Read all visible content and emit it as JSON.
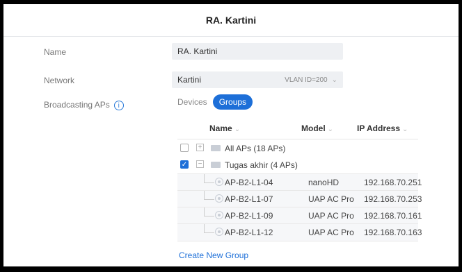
{
  "title": "RA. Kartini",
  "form": {
    "name_label": "Name",
    "name_value": "RA. Kartini",
    "network_label": "Network",
    "network_value": "Kartini",
    "vlan": "VLAN ID=200",
    "aps_label": "Broadcasting APs",
    "info_glyph": "i"
  },
  "tabs": {
    "devices": "Devices",
    "groups": "Groups"
  },
  "table": {
    "headers": {
      "name": "Name",
      "model": "Model",
      "ip": "IP Address"
    },
    "groups": [
      {
        "toggle": "+",
        "name": "All APs (18 APs)",
        "checked": false
      },
      {
        "toggle": "−",
        "name": "Tugas akhir (4 APs)",
        "checked": true
      }
    ],
    "aps": [
      {
        "name": "AP-B2-L1-04",
        "model": "nanoHD",
        "ip": "192.168.70.251"
      },
      {
        "name": "AP-B2-L1-07",
        "model": "UAP AC Pro",
        "ip": "192.168.70.253"
      },
      {
        "name": "AP-B2-L1-09",
        "model": "UAP AC Pro",
        "ip": "192.168.70.161"
      },
      {
        "name": "AP-B2-L1-12",
        "model": "UAP AC Pro",
        "ip": "192.168.70.163"
      }
    ]
  },
  "create_group": "Create New Group",
  "colors": {
    "accent": "#1d6fd8",
    "field_bg": "#eef0f3"
  },
  "icons": {
    "chevron": "chevron-down-icon",
    "info": "info-icon",
    "folder": "folder-icon",
    "ap": "ap-icon"
  }
}
